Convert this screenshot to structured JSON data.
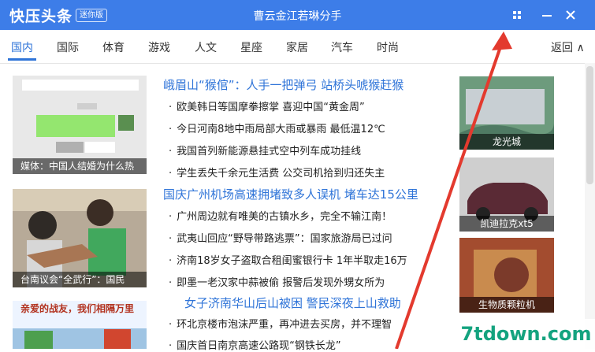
{
  "app": {
    "logo": "快压头条",
    "badge": "迷你版",
    "window_title": "曹云金江若琳分手"
  },
  "tabs": [
    "国内",
    "国际",
    "体育",
    "游戏",
    "人文",
    "星座",
    "家居",
    "汽车",
    "时尚"
  ],
  "back_label": "返回 ∧",
  "left_cards": [
    {
      "caption": "媒体：中国人结婚为什么热"
    },
    {
      "caption": "台南议会“全武行”：国民"
    },
    {
      "caption": "亲爱的战友，我们相隔万里"
    }
  ],
  "news": {
    "headline1": "峨眉山“猴倌”：人手一把弹弓 站桥头唬猴赶猴",
    "items1": [
      "欧美韩日等国摩拳擦掌 喜迎中国“黄金周”",
      "今日河南8地中雨局部大雨或暴雨 最低温12℃",
      "我国首列新能源悬挂式空中列车成功挂线",
      "学生丢失千余元生活费 公交司机拾到归还失主"
    ],
    "headline2": "国庆广州机场高速拥堵致多人误机 堵车达15公里",
    "items2": [
      "广州周边就有唯美的古镇水乡，完全不输江南！",
      "武夷山回应“野导带路逃票”：国家旅游局已过问",
      "济南18岁女子盗取合租闺蜜银行卡 1年半取走16万",
      "即墨一老汉家中蒜被偷 报警后发现外甥女所为"
    ],
    "headline3": "女子济南华山后山被困 警民深夜上山救助",
    "items3": [
      "环北京楼市泡沫严重，再冲进去买房，并不理智",
      "国庆首日南京高速公路现“钢铁长龙”"
    ]
  },
  "right_cards": [
    {
      "caption": "龙光城"
    },
    {
      "caption": "凯迪拉克xt5"
    },
    {
      "caption": "生物质颗粒机"
    }
  ],
  "watermark": "7tdown.com"
}
